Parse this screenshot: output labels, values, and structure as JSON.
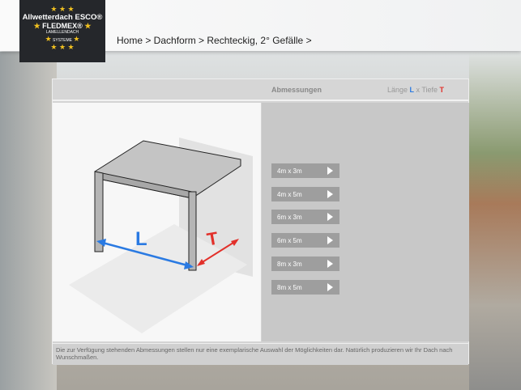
{
  "logo": {
    "stars_top": "★ ★ ★",
    "brand": "Allwetterdach ESCO®",
    "product": "FLEDMEX®",
    "sub1": "LAMELLENDACH",
    "sub2": "SYSTEME",
    "stars_bottom": "★ ★ ★"
  },
  "breadcrumb": "Home > Dachform > Rechteckig, 2° Gefälle >",
  "panel": {
    "title": "Abmessungen",
    "legend_pre": "Länge ",
    "legend_L": "L",
    "legend_mid": " x Tiefe ",
    "legend_T": "T"
  },
  "diagram": {
    "label_L": "L",
    "label_T": "T"
  },
  "options": [
    "4m x 3m",
    "4m x 5m",
    "6m x 3m",
    "6m x 5m",
    "8m x 3m",
    "8m x 5m"
  ],
  "footer": "Die zur Verfügung stehenden Abmessungen stellen nur eine exemplarische Auswahl der Möglichkeiten dar. Natürlich produzieren wir Ihr Dach nach Wunschmaßen.",
  "colors": {
    "length": "#2a7ae2",
    "depth": "#e2302a"
  }
}
